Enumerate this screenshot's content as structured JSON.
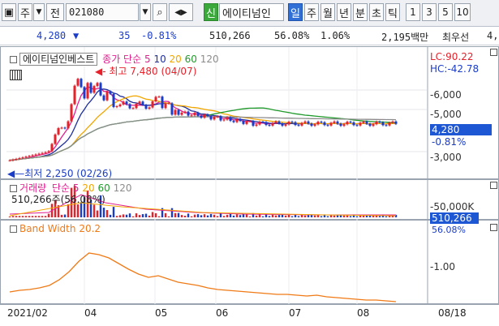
{
  "toolbar": {
    "market": "주",
    "period_label": "전",
    "code": "021080",
    "stock_badge": "신",
    "stock_name": "에이티넘인",
    "period_buttons": [
      "일",
      "주",
      "월",
      "년",
      "분",
      "초",
      "틱"
    ],
    "minute_buttons": [
      "1",
      "3",
      "5",
      "10"
    ]
  },
  "info": {
    "price": "4,280",
    "change": "35",
    "change_pct": "-0.81%",
    "volume": "510,266",
    "vol_ratio": "56.08%",
    "turnover": "1.06%",
    "amount": "2,195백만",
    "preferred": "최우선",
    "preferred_val": "4,"
  },
  "price_panel": {
    "name": "에이티넘인베스트",
    "ma_label": "종가 단순",
    "ma_periods": [
      "5",
      "10",
      "20",
      "60",
      "120"
    ],
    "ma_colors": [
      "#e0208f",
      "#1f2f9c",
      "#f2a600",
      "#1f9a2a",
      "#8c8c8c"
    ],
    "high_note": "최고 7,480 (04/07)",
    "low_note": "최저 2,250 (02/26)",
    "lc": "LC:90.22",
    "hc": "HC:-42.78",
    "yticks": [
      "6,000",
      "5,000",
      "3,000"
    ],
    "current": "4,280",
    "current_pct": "-0.81%"
  },
  "volume_panel": {
    "title": "거래량",
    "ma_label": "단순",
    "ma_periods": [
      "5",
      "20",
      "60",
      "120"
    ],
    "value_text": "510,266주(56.08%)",
    "ytick": "50,000K",
    "current": "510,266",
    "current_pct": "56.08%"
  },
  "band_panel": {
    "title": "Band Width",
    "value": "20.2",
    "ytick": "1.00"
  },
  "xaxis": {
    "labels": [
      "2021/02",
      "04",
      "05",
      "06",
      "07",
      "08"
    ],
    "right_label": "08/18"
  },
  "colors": {
    "up": "#e8202a",
    "down": "#1a3cc8",
    "band": "#f07a16"
  }
}
